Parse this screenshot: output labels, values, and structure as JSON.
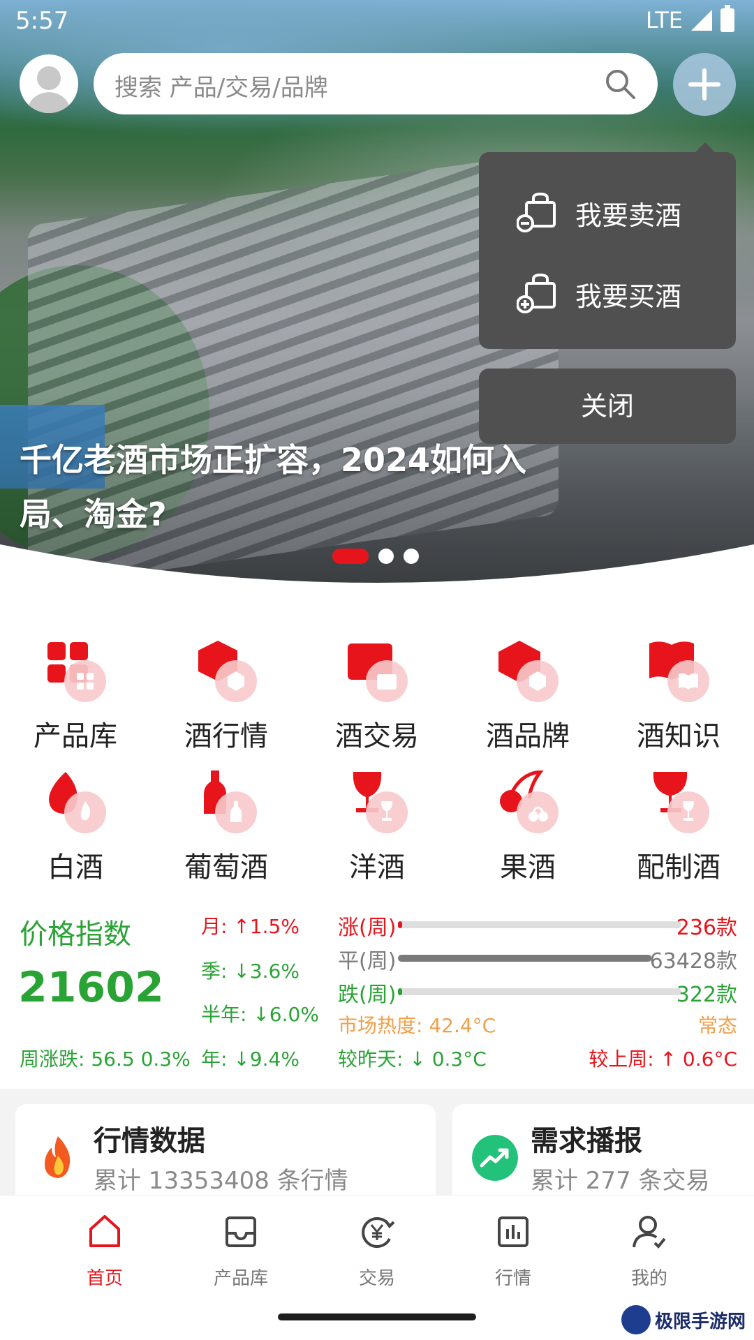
{
  "status": {
    "time": "5:57",
    "network": "LTE"
  },
  "search": {
    "placeholder": "搜索 产品/交易/品牌"
  },
  "popup": {
    "sell_label": "我要卖酒",
    "buy_label": "我要买酒",
    "close_label": "关闭"
  },
  "banner": {
    "title": "千亿老酒市场正扩容，2024如何入局、淘金?",
    "dots_total": 3,
    "active_dot": 1
  },
  "categories": [
    {
      "label": "产品库",
      "icon": "grid-icon"
    },
    {
      "label": "酒行情",
      "icon": "market-hexagon-icon"
    },
    {
      "label": "酒交易",
      "icon": "yen-wallet-icon"
    },
    {
      "label": "酒品牌",
      "icon": "brand-cube-icon"
    },
    {
      "label": "酒知识",
      "icon": "book-icon"
    },
    {
      "label": "白酒",
      "icon": "flame-icon"
    },
    {
      "label": "葡萄酒",
      "icon": "bottle-icon"
    },
    {
      "label": "洋酒",
      "icon": "brandy-glass-icon"
    },
    {
      "label": "果酒",
      "icon": "cherry-icon"
    },
    {
      "label": "配制酒",
      "icon": "wine-glass-icon"
    }
  ],
  "price_index": {
    "title": "价格指数",
    "value": "21602",
    "weekly": "周涨跌: 56.5 0.3%",
    "month": "月: ↑1.5%",
    "quarter": "季: ↓3.6%",
    "half_year": "半年: ↓6.0%",
    "year": "年: ↓9.4%",
    "rise_label": "涨(周)",
    "rise_count": "236款",
    "rise_share": 0.0037,
    "flat_label": "平(周)",
    "flat_count": "63428款",
    "flat_share": 0.9914,
    "fall_label": "跌(周)",
    "fall_count": "322款",
    "fall_share": 0.005,
    "heat": "市场热度: 42.4°C",
    "heat_state": "常态",
    "vs_yesterday": "较昨天: ↓ 0.3°C",
    "vs_last_week": "较上周: ↑ 0.6°C"
  },
  "cards": [
    {
      "title": "行情数据",
      "subtitle": "累计 13353408 条行情",
      "icon": "fire-icon"
    },
    {
      "title": "需求播报",
      "subtitle": "累计 277 条交易",
      "icon": "trend-up-icon"
    }
  ],
  "nav": [
    {
      "label": "首页",
      "icon": "home-icon",
      "active": true
    },
    {
      "label": "产品库",
      "icon": "inbox-icon",
      "active": false
    },
    {
      "label": "交易",
      "icon": "yen-exchange-icon",
      "active": false
    },
    {
      "label": "行情",
      "icon": "chart-icon",
      "active": false
    },
    {
      "label": "我的",
      "icon": "user-icon",
      "active": false
    }
  ],
  "watermark": "极限手游网",
  "colors": {
    "accent_red": "#e8141b",
    "accent_green": "#2aa335",
    "popup_bg": "#505050",
    "heat_orange": "#f0a04b"
  }
}
